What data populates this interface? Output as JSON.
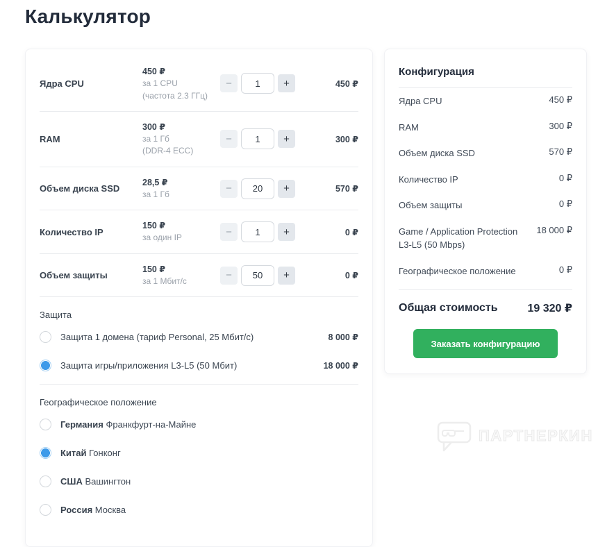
{
  "page": {
    "title": "Калькулятор"
  },
  "calculator": {
    "rows": [
      {
        "label": "Ядра CPU",
        "price": "450 ₽",
        "unit": "за 1 CPU",
        "note": "(частота 2.3 ГГц)",
        "quantity": "1",
        "total": "450 ₽"
      },
      {
        "label": "RAM",
        "price": "300 ₽",
        "unit": "за 1 Гб",
        "note": "(DDR-4 ECC)",
        "quantity": "1",
        "total": "300 ₽"
      },
      {
        "label": "Объем диска SSD",
        "price": "28,5 ₽",
        "unit": "за 1 Гб",
        "note": "",
        "quantity": "20",
        "total": "570 ₽"
      },
      {
        "label": "Количество IP",
        "price": "150 ₽",
        "unit": "за один IP",
        "note": "",
        "quantity": "1",
        "total": "0 ₽"
      },
      {
        "label": "Объем защиты",
        "price": "150 ₽",
        "unit": "за 1 Мбит/с",
        "note": "",
        "quantity": "50",
        "total": "0 ₽"
      }
    ],
    "stepper": {
      "minus": "−",
      "plus": "+"
    },
    "protection": {
      "heading": "Защита",
      "options": [
        {
          "label": "Защита 1 домена (тариф Personal, 25 Мбит/с)",
          "price": "8 000 ₽",
          "selected": false
        },
        {
          "label": "Защита игры/приложения L3-L5 (50 Мбит)",
          "price": "18 000 ₽",
          "selected": true
        }
      ]
    },
    "geography": {
      "heading": "Географическое положение",
      "options": [
        {
          "country": "Германия",
          "city": "Франкфурт-на-Майне",
          "selected": false
        },
        {
          "country": "Китай",
          "city": "Гонконг",
          "selected": true
        },
        {
          "country": "США",
          "city": "Вашингтон",
          "selected": false
        },
        {
          "country": "Россия",
          "city": "Москва",
          "selected": false
        }
      ]
    }
  },
  "configuration": {
    "heading": "Конфигурация",
    "items": [
      {
        "label": "Ядра CPU",
        "value": "450 ₽"
      },
      {
        "label": "RAM",
        "value": "300 ₽"
      },
      {
        "label": "Объем диска SSD",
        "value": "570 ₽"
      },
      {
        "label": "Количество IP",
        "value": "0 ₽"
      },
      {
        "label": "Объем защиты",
        "value": "0 ₽"
      },
      {
        "label": "Game / Application Protection L3-L5 (50 Mbps)",
        "value": "18 000 ₽"
      },
      {
        "label": "Географическое положение",
        "value": "0 ₽"
      }
    ],
    "total_label": "Общая стоимость",
    "total_value": "19 320 ₽",
    "order_button": "Заказать конфигурацию"
  },
  "watermark": {
    "text": "ПАРТНЕРКИН"
  },
  "colors": {
    "accent_green": "#31b05e",
    "accent_blue": "#3d9ae9",
    "title": "#222b3a"
  }
}
